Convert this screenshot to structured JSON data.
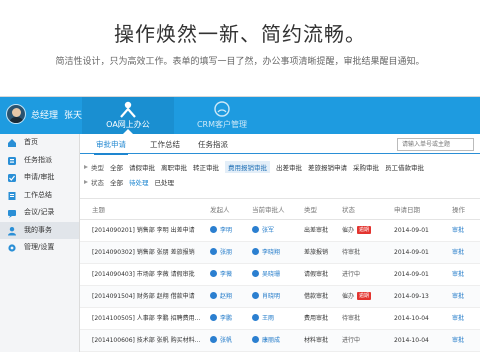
{
  "hero": {
    "title": "操作焕然一新、简约流畅。",
    "subtitle": "简洁性设计，只为高效工作。表单的填写一目了然，办公事项清晰提醒，审批结果醒目通知。"
  },
  "topbar": {
    "user_role": "总经理",
    "user_name": "张天",
    "modules": [
      {
        "label": "OA网上办公",
        "icon": "people-icon",
        "active": true
      },
      {
        "label": "CRM客户管理",
        "icon": "crm-circle-icon",
        "active": false
      }
    ]
  },
  "sidebar": {
    "items": [
      {
        "label": "首页",
        "icon": "home-icon",
        "color": "#2a8fd6"
      },
      {
        "label": "任务指派",
        "icon": "task-icon",
        "color": "#2a8fd6"
      },
      {
        "label": "申请/审批",
        "icon": "approve-icon",
        "color": "#2a8fd6"
      },
      {
        "label": "工作总结",
        "icon": "summary-icon",
        "color": "#2a8fd6"
      },
      {
        "label": "会议/记录",
        "icon": "meeting-icon",
        "color": "#2a8fd6"
      },
      {
        "label": "我的事务",
        "icon": "affairs-icon",
        "color": "#2a8fd6",
        "active": true
      },
      {
        "label": "管理/设置",
        "icon": "settings-icon",
        "color": "#2a8fd6"
      }
    ]
  },
  "tabs": [
    {
      "label": "审批申请",
      "active": true
    },
    {
      "label": "工作总结",
      "active": false
    },
    {
      "label": "任务指派",
      "active": false
    }
  ],
  "search": {
    "placeholder": "请输入单号或主题"
  },
  "filters": {
    "type": {
      "label": "类型",
      "options": [
        "全部",
        "请假审批",
        "离职审批",
        "转正审批",
        "费用报销审批",
        "出差审批",
        "差旅报销申请",
        "采购审批",
        "员工借款审批"
      ],
      "highlighted": "费用报销审批"
    },
    "status": {
      "label": "状态",
      "options": [
        "全部",
        "待处理",
        "已处理"
      ],
      "selected": "待处理"
    }
  },
  "table": {
    "columns": [
      "主题",
      "发起人",
      "当前审批人",
      "类型",
      "状态",
      "申请日期",
      "操作"
    ],
    "rows": [
      {
        "subject": "[2014090201] 销售部 李明  出差申请",
        "initiator": "李明",
        "approver": "张军",
        "type": "出差审批",
        "status": "催办",
        "badge": "逾期",
        "date": "2014-09-01",
        "action": "审批"
      },
      {
        "subject": "[2014090302] 销售部 张朋  差旅报销",
        "initiator": "张朋",
        "approver": "李晓翔",
        "type": "差旅报销",
        "status": "待审批",
        "badge": "",
        "date": "2014-09-01",
        "action": "审批"
      },
      {
        "subject": "[2014090403] 市场部 李薇  请假审批",
        "initiator": "李薇",
        "approver": "吴晓珊",
        "type": "请假审批",
        "status": "进行中",
        "badge": "",
        "date": "2014-09-01",
        "action": "审批"
      },
      {
        "subject": "[2014091504] 财务部 赵翔  借款申请",
        "initiator": "赵翔",
        "approver": "肖晓明",
        "type": "借款审批",
        "status": "催办",
        "badge": "逾期",
        "date": "2014-09-13",
        "action": "审批"
      },
      {
        "subject": "[2014100505] 人事部 李鹏  招聘费用...",
        "initiator": "李鹏",
        "approver": "王雨",
        "type": "费用审批",
        "status": "待审批",
        "badge": "",
        "date": "2014-10-04",
        "action": "审批"
      },
      {
        "subject": "[2014100606] 技术部 张帆  购买材料...",
        "initiator": "张帆",
        "approver": "康丽成",
        "type": "材料审批",
        "status": "进行中",
        "badge": "",
        "date": "2014-10-04",
        "action": "审批"
      }
    ]
  }
}
